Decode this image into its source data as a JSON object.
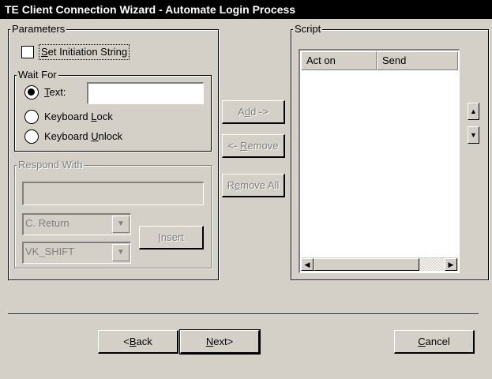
{
  "window": {
    "title": "TE Client Connection Wizard - Automate Login Process"
  },
  "parameters": {
    "legend": "Parameters",
    "set_initiation_string": {
      "label": "Set Initiation String",
      "checked": false
    }
  },
  "wait_for": {
    "legend": "Wait For",
    "options": [
      {
        "label": "Text:",
        "selected": true
      },
      {
        "label": "Keyboard Lock",
        "selected": false
      },
      {
        "label": "Keyboard Unlock",
        "selected": false
      }
    ],
    "text_value": ""
  },
  "respond_with": {
    "legend": "Respond With",
    "text_value": "",
    "key_combo": {
      "value": "C. Return"
    },
    "modifier_combo": {
      "value": "VK_SHIFT"
    },
    "insert_label": "Insert"
  },
  "middle_buttons": {
    "add": "Add ->",
    "remove": "<- Remove",
    "remove_all": "Remove All"
  },
  "script": {
    "legend": "Script",
    "columns": [
      "Act on",
      "Send"
    ],
    "rows": []
  },
  "footer": {
    "back": "<Back",
    "next": "Next>",
    "cancel": "Cancel"
  },
  "icons": {
    "scroll_up": "up-arrow-icon",
    "scroll_down": "down-arrow-icon",
    "scroll_left": "left-arrow-icon",
    "scroll_right": "right-arrow-icon",
    "dropdown": "chevron-down-icon"
  }
}
